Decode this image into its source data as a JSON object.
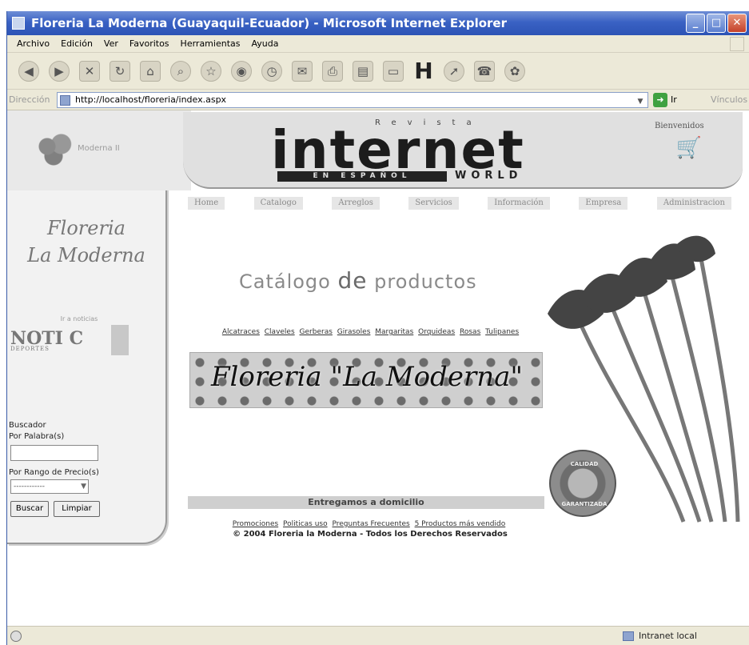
{
  "window": {
    "title": "Floreria La Moderna (Guayaquil-Ecuador) - Microsoft Internet Explorer",
    "buttons": [
      "_",
      "□",
      "✕"
    ]
  },
  "menu": [
    "Archivo",
    "Edición",
    "Ver",
    "Favoritos",
    "Herramientas",
    "Ayuda"
  ],
  "toolbar": {
    "back_icon": "back-icon",
    "forward_icon": "forward-icon",
    "stop_icon": "stop-icon",
    "refresh_icon": "refresh-icon",
    "home_icon": "home-icon",
    "search_icon": "search-icon",
    "favorites_icon": "favorites-icon",
    "media_icon": "media-icon",
    "history_icon": "history-icon",
    "mail_icon": "mail-icon",
    "print_icon": "print-icon",
    "edit_icon": "edit-icon",
    "discuss_icon": "discuss-icon",
    "h_label": "H"
  },
  "address": {
    "label": "Dirección",
    "url": "http://localhost/floreria/index.aspx",
    "go_label": "Ir",
    "links_label": "Vínculos »"
  },
  "header": {
    "topleft_text": "Moderna II",
    "revista": "Revista",
    "internet": "internet",
    "espanol": "EN ESPAÑOL",
    "world": "WORLD",
    "bienvenidos": "Bienvenidos"
  },
  "nav": [
    "Home",
    "Catalogo",
    "Arreglos",
    "Servicios",
    "Información",
    "Empresa",
    "Administracion"
  ],
  "left": {
    "brand_line1": "Floreria",
    "brand_line2": "La Moderna",
    "noti_sub": "Ir a noticias",
    "noti": "NOTI C",
    "noti_small": "DEPORTES",
    "search_title": "Buscador",
    "search_by_word": "Por Palabra(s)",
    "search_word_value": "",
    "search_by_price": "Por Rango de Precio(s)",
    "price_selected": "------------",
    "search_button": "Buscar",
    "clear_button": "Limpiar"
  },
  "main": {
    "catalog_title_a": "Catálogo",
    "catalog_title_b": "de",
    "catalog_title_c": "productos",
    "categories": [
      "Alcatraces",
      "Claveles",
      "Gerberas",
      "Girasoles",
      "Margaritas",
      "Orquideas",
      "Rosas",
      "Tulipanes"
    ],
    "banner_text": "Floreria \"La Moderna\"",
    "delivery": "Entregamos a domicilio",
    "footer_links": [
      "Promociones",
      "Politicas uso",
      "Preguntas Frecuentes",
      "5 Productos más vendido"
    ],
    "copyright": "© 2004 Floreria la Moderna - Todos los Derechos Reservados",
    "badge_top": "CALIDAD",
    "badge_bottom": "GARANTIZADA"
  },
  "status": {
    "zone": "Intranet local"
  }
}
